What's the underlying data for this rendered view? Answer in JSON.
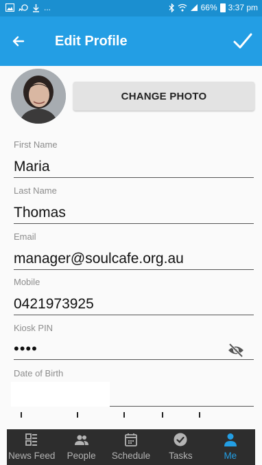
{
  "status_bar": {
    "left_icons": [
      "image-icon",
      "cast-icon",
      "download-icon"
    ],
    "left_text": "...",
    "battery": "66%",
    "time": "3:37 pm"
  },
  "toolbar": {
    "title": "Edit Profile"
  },
  "photo": {
    "button_label": "CHANGE PHOTO"
  },
  "fields": {
    "first_name": {
      "label": "First Name",
      "value": "Maria"
    },
    "last_name": {
      "label": "Last Name",
      "value": "Thomas"
    },
    "email": {
      "label": "Email",
      "value": "manager@soulcafe.org.au"
    },
    "mobile": {
      "label": "Mobile",
      "value": "0421973925"
    },
    "kiosk_pin": {
      "label": "Kiosk PIN",
      "value": "••••"
    },
    "date_of_birth": {
      "label": "Date of Birth",
      "value": ""
    }
  },
  "colors": {
    "accent": "#239ee4",
    "status_bar": "#1b8fd0",
    "nav_background": "#2d2d2d"
  },
  "bottom_nav": {
    "items": [
      {
        "label": "News Feed",
        "icon": "news-feed-icon"
      },
      {
        "label": "People",
        "icon": "people-icon"
      },
      {
        "label": "Schedule",
        "icon": "calendar-icon"
      },
      {
        "label": "Tasks",
        "icon": "check-circle-icon"
      },
      {
        "label": "Me",
        "icon": "person-icon",
        "active": true
      }
    ]
  }
}
